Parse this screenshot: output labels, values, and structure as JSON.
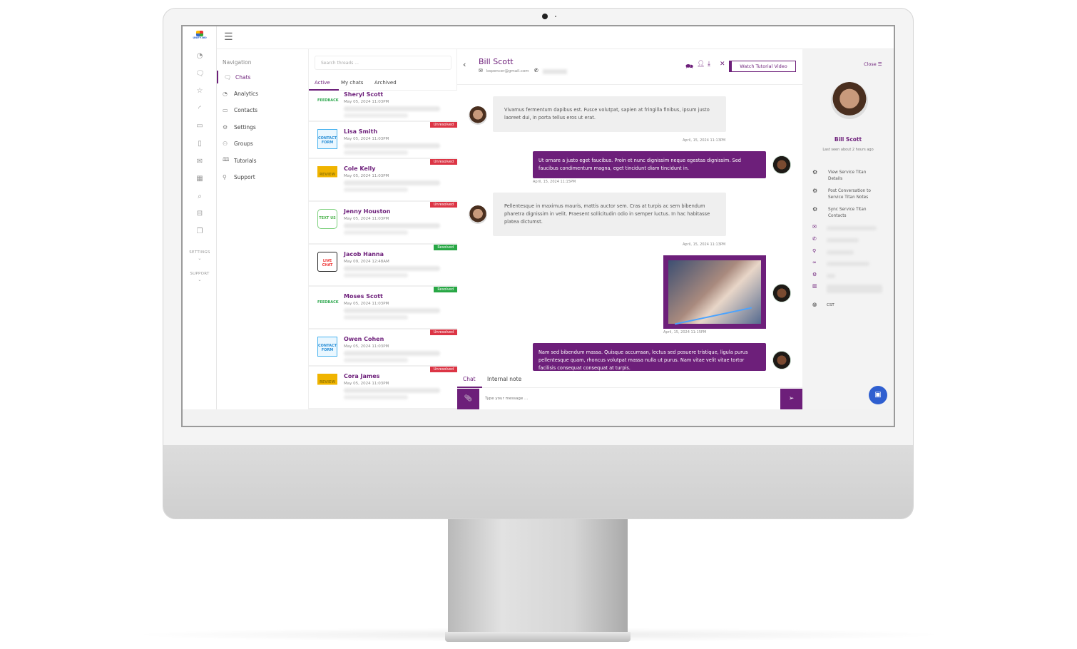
{
  "brand": {
    "logo_text": "UNIFY360"
  },
  "colors": {
    "accent": "#6d1f7a",
    "unresolved": "#dc3545",
    "resolved": "#28a745",
    "bubble_in": "#efefef"
  },
  "rail": {
    "icons": [
      "dashboard-icon",
      "chat-icon",
      "star-icon",
      "rss-icon",
      "contacts-icon",
      "mobile-icon",
      "mail-icon",
      "building-icon",
      "search-icon",
      "inbox-icon",
      "document-icon"
    ],
    "settings_label": "SETTINGS",
    "support_label": "SUPPORT"
  },
  "nav": {
    "title": "Navigation",
    "items": [
      {
        "label": "Chats",
        "icon": "chat-icon"
      },
      {
        "label": "Analytics",
        "icon": "gauge-icon"
      },
      {
        "label": "Contacts",
        "icon": "contacts-icon"
      },
      {
        "label": "Settings",
        "icon": "gear-icon"
      },
      {
        "label": "Groups",
        "icon": "groups-icon"
      },
      {
        "label": "Tutorials",
        "icon": "book-icon"
      },
      {
        "label": "Support",
        "icon": "support-icon"
      }
    ]
  },
  "threads": {
    "search_placeholder": "Search threads ...",
    "tabs": [
      "Active",
      "My chats",
      "Archived"
    ],
    "items": [
      {
        "name": "Sheryl Scott",
        "date": "May 05, 2024 11:03PM",
        "source": "FEEDBACK",
        "status": ""
      },
      {
        "name": "Lisa Smith",
        "date": "May 05, 2024 11:03PM",
        "source": "CONTACT FORM",
        "status": "Unresolved"
      },
      {
        "name": "Cole Kelly",
        "date": "May 05, 2024 11:03PM",
        "source": "REVIEW",
        "status": "Unresolved"
      },
      {
        "name": "Jenny Houston",
        "date": "May 05, 2024 11:03PM",
        "source": "TEXT US",
        "status": "Unresolved"
      },
      {
        "name": "Jacob Hanna",
        "date": "May 09, 2024 12:48AM",
        "source": "LIVE CHAT",
        "status": "Resolved"
      },
      {
        "name": "Moses Scott",
        "date": "May 05, 2024 11:03PM",
        "source": "FEEDBACK",
        "status": "Resolved"
      },
      {
        "name": "Owen Cohen",
        "date": "May 05, 2024 11:03PM",
        "source": "CONTACT FORM",
        "status": "Unresolved"
      },
      {
        "name": "Cora James",
        "date": "May 05, 2024 11:03PM",
        "source": "REVIEW",
        "status": "Unresolved"
      }
    ]
  },
  "chat": {
    "contact_name": "Bill Scott",
    "email": "bspencer@gmail.com",
    "watch_button": "Watch Tutorial Video",
    "messages": [
      {
        "dir": "in",
        "text": "Vivamus fermentum dapibus est. Fusce volutpat, sapien at fringilla finibus, ipsum justo laoreet dui, in porta tellus eros ut erat.",
        "time": "April, 15, 2024 11:13PM"
      },
      {
        "dir": "out",
        "text": "Ut ornare a justo eget faucibus. Proin et nunc dignissim neque egestas dignissim. Sed faucibus condimentum magna, eget tincidunt diam tincidunt in.",
        "time": "April, 15, 2024 11:15PM"
      },
      {
        "dir": "in",
        "text": "Pellentesque in maximus mauris, mattis auctor sem. Cras at turpis ac sem bibendum pharetra dignissim in velit. Praesent sollicitudin odio in semper luctus. In hac habitasse platea dictumst.",
        "time": "April, 15, 2024 11:13PM"
      },
      {
        "dir": "out",
        "type": "image",
        "time": "April, 15, 2024 11:15PM"
      },
      {
        "dir": "out",
        "text": "Nam sed bibendum massa. Quisque accumsan, lectus sed posuere tristique, ligula purus pellentesque quam, rhoncus volutpat massa nulla ut purus. Nam vitae velit vitae tortor facilisis consequat consequat at turpis."
      }
    ],
    "compose_tabs": [
      "Chat",
      "Internal note"
    ],
    "input_placeholder": "Type your message ..."
  },
  "profile": {
    "close_label": "Close ☰",
    "name": "Bill Scott",
    "last_seen": "Last seen about 2 hours ago",
    "actions": [
      "View Service Titan Details",
      "Post Conversation to Service Titan Notes",
      "Sync Service Titan Contacts"
    ],
    "timezone": "CST"
  }
}
